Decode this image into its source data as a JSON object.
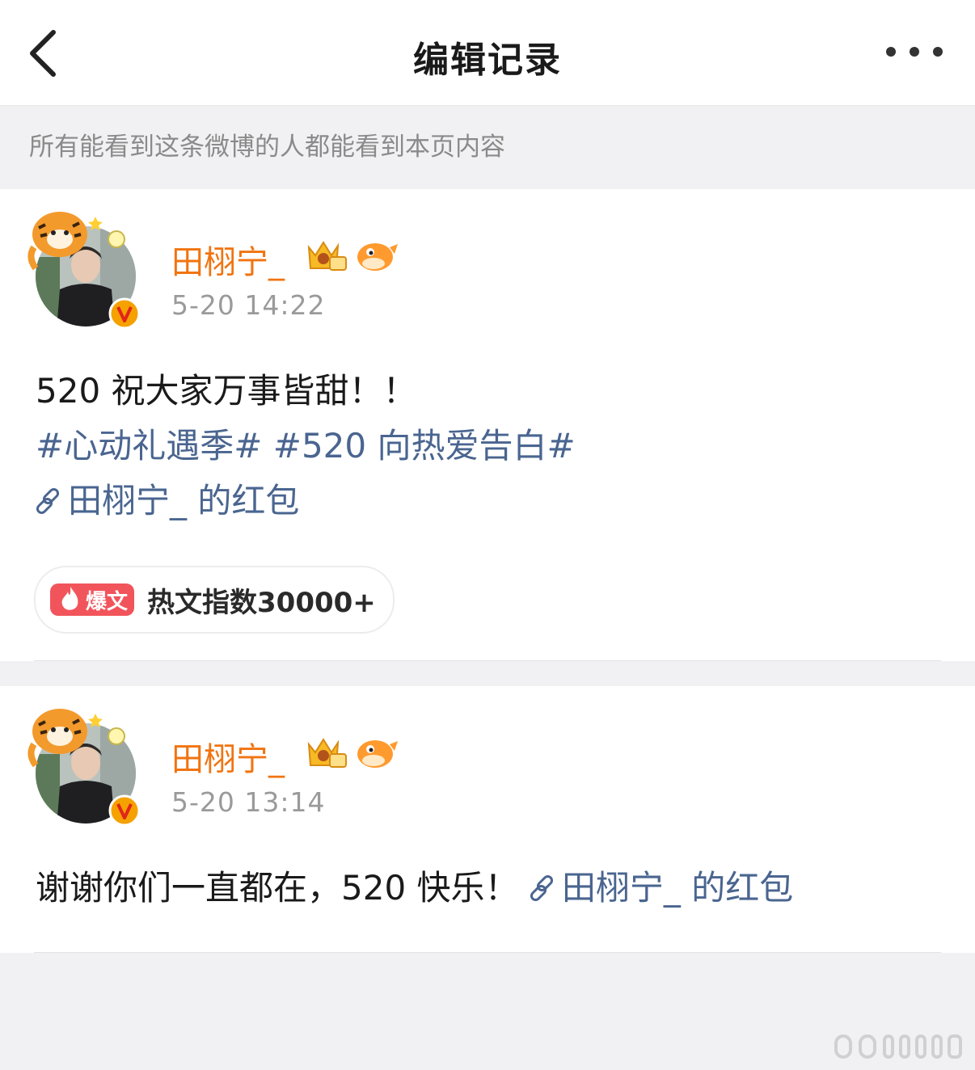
{
  "header": {
    "title": "编辑记录"
  },
  "notice": "所有能看到这条微博的人都能看到本页内容",
  "colors": {
    "username": "#f17410",
    "link": "#4a6590",
    "hot_badge": "#f2545b",
    "verified_badge": "#f5a100"
  },
  "icons": {
    "back": "chevron-left-icon",
    "more": "more-dots-icon",
    "link": "link-icon",
    "verified": "verified-v-icon",
    "crown": "crown-badge-icon",
    "fish": "fish-badge-icon",
    "fire": "fire-icon"
  },
  "posts": [
    {
      "username": "田栩宁_",
      "timestamp": "5-20 14:22",
      "text_line1": "520 祝大家万事皆甜！！",
      "hashtag1": "#心动礼遇季#",
      "hashtag2": "#520 向热爱告白#",
      "link_text": "田栩宁_ 的红包",
      "hot_badge_label": "爆文",
      "hot_text": "热文指数30000+"
    },
    {
      "username": "田栩宁_",
      "timestamp": "5-20 13:14",
      "text": "谢谢你们一直都在，520 快乐！",
      "link_text": "田栩宁_ 的红包"
    }
  ]
}
